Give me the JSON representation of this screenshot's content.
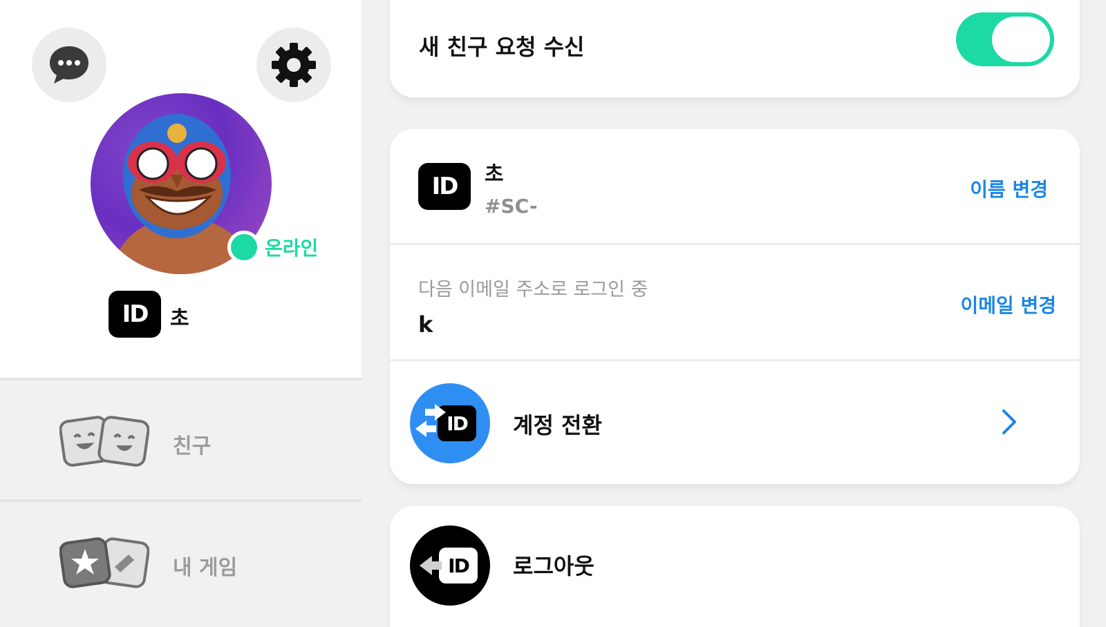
{
  "profile": {
    "status": "온라인",
    "id_badge": "ID",
    "name": "초"
  },
  "nav": {
    "friends": "친구",
    "my_games": "내 게임"
  },
  "settings": {
    "friend_request_label": "새 친구 요청 수신",
    "friend_request_enabled": true
  },
  "account": {
    "id_badge": "ID",
    "name": "초",
    "tag": "#SC-",
    "change_name": "이름 변경",
    "email_caption": "다음 이메일 주소로 로그인 중",
    "email_value": "k",
    "change_email": "이메일 변경",
    "switch_account": "계정 전환",
    "logout": "로그아웃"
  },
  "colors": {
    "accent_green": "#1dd9a4",
    "link_blue": "#1b86e3",
    "switch_blue": "#2f8ef2"
  }
}
